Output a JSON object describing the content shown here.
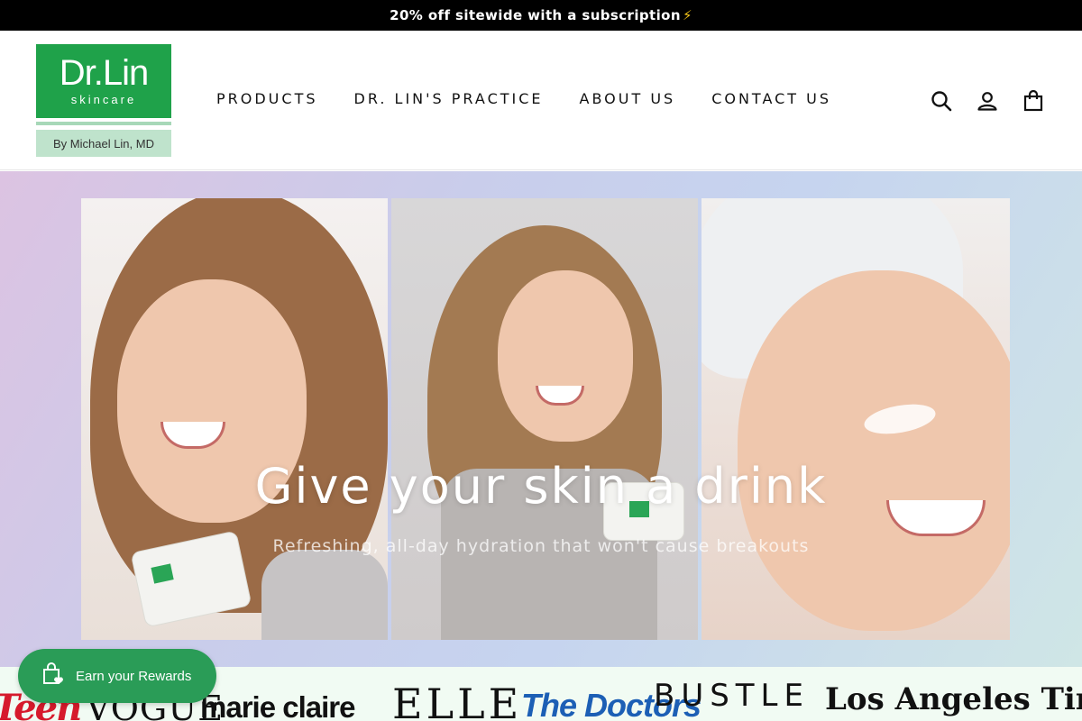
{
  "announcement": {
    "text": "20% off sitewide with a subscription",
    "emoji": "⚡"
  },
  "logo": {
    "brand": "Dr.Lin",
    "sub": "skincare",
    "byline": "By Michael Lin, MD"
  },
  "nav": {
    "items": [
      {
        "label": "PRODUCTS"
      },
      {
        "label": "DR. LIN'S PRACTICE"
      },
      {
        "label": "ABOUT US"
      },
      {
        "label": "CONTACT US"
      }
    ]
  },
  "header_icons": [
    "search-icon",
    "account-icon",
    "cart-icon"
  ],
  "hero": {
    "title": "Give your skin a drink",
    "subtitle": "Refreshing, all-day hydration that won't cause breakouts"
  },
  "press": {
    "logos": [
      "Teen",
      "VOGUE",
      "marie claire",
      "ELLE",
      "The Doctors",
      "BUSTLE",
      "Los Angeles Times"
    ]
  },
  "rewards": {
    "label": "Earn your Rewards"
  },
  "colors": {
    "brand_green": "#1fa24a",
    "announce_bg": "#000000",
    "rewards_green": "#2a9c57"
  }
}
